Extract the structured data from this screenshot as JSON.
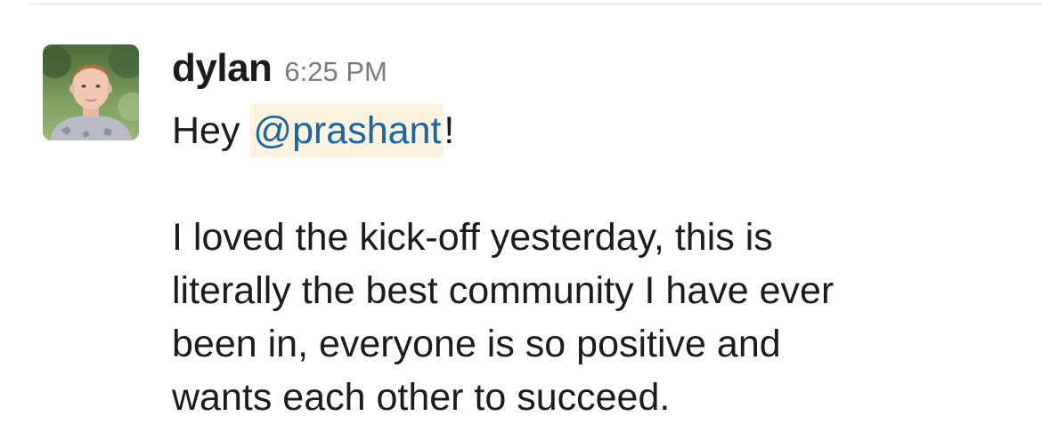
{
  "message": {
    "author": "dylan",
    "timestamp": "6:25 PM",
    "avatar_icon": "user-photo-icon",
    "greeting_prefix": "Hey ",
    "mention": "@prashant",
    "greeting_suffix": "!",
    "paragraph_lines": [
      "I loved the kick-off yesterday, this is",
      "literally the best community I have ever",
      "been in, everyone is so positive and",
      "wants each other to succeed."
    ]
  },
  "colors": {
    "mention_text": "#1a64a8",
    "mention_background": "#fbf3dd",
    "timestamp": "#7b7b7b",
    "text": "#1d1c1d"
  }
}
